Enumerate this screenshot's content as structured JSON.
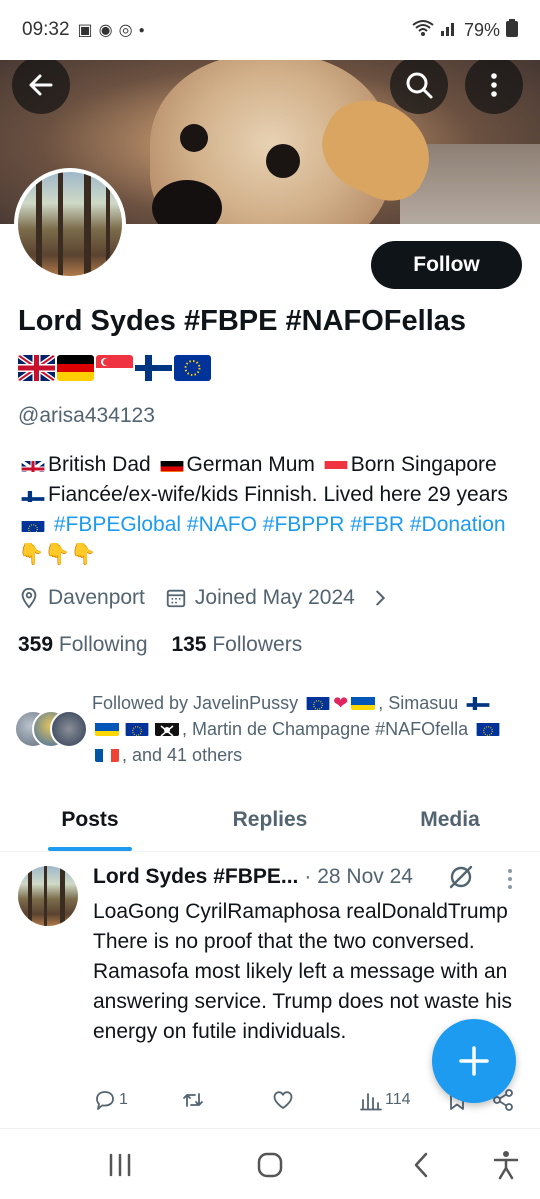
{
  "status_bar": {
    "time": "09:32",
    "battery": "79%"
  },
  "header": {
    "back_icon": "arrow-left-icon",
    "search_icon": "search-icon",
    "more_icon": "more-vertical-icon"
  },
  "profile": {
    "follow_label": "Follow",
    "name": "Lord Sydes #FBPE #NAFOFellas",
    "handle": "@arisa434123",
    "bio": {
      "t1": "British Dad",
      "t2": "German Mum",
      "t3": "Born Singapore",
      "t4": "Fiancée/ex-wife/kids Finnish. Lived here 29 years",
      "h1": "#FBPEGlobal",
      "h2": "#NAFO",
      "h3": "#FBPPR",
      "h4": "#FBR",
      "h5": "#Donation",
      "emoji_end": "👇👇👇"
    },
    "location": "Davenport",
    "joined": "Joined May 2024",
    "following_count": "359",
    "following_label": "Following",
    "followers_count": "135",
    "followers_label": "Followers",
    "followed_by": {
      "a": "Followed by JavelinPussy",
      "b": ", Simasuu",
      "c": ", Martin de Champagne #NAFOfella",
      "d": ", and 41 others"
    }
  },
  "tabs": [
    {
      "label": "Posts"
    },
    {
      "label": "Replies"
    },
    {
      "label": "Media"
    }
  ],
  "post": {
    "author": "Lord Sydes #FBPE...",
    "date": "· 28 Nov 24",
    "text": "LoaGong CyrilRamaphosa realDonaldTrump There is no proof that the two conversed. Ramasofa most likely left a message with an answering service. Trump does not waste his energy on futile individuals.",
    "replies": "1",
    "reposts": "",
    "likes": "",
    "views": "114"
  },
  "colors": {
    "accent": "#1d9bf0",
    "text": "#0f1419",
    "muted": "#536471"
  }
}
